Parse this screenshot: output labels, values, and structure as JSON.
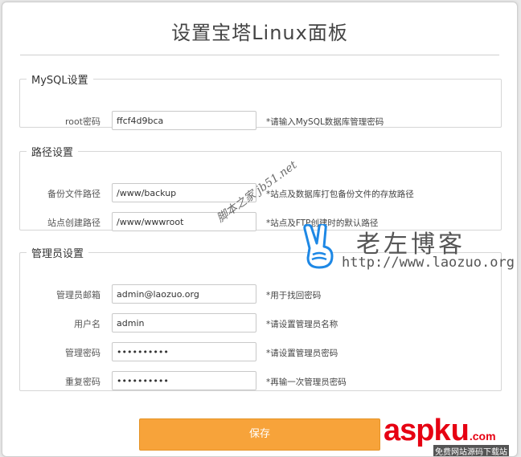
{
  "header": {
    "title": "设置宝塔Linux面板"
  },
  "mysql": {
    "legend": "MySQL设置",
    "root": {
      "label": "root密码",
      "value": "ffcf4d9bca",
      "hint": "*请输入MySQL数据库管理密码"
    }
  },
  "paths": {
    "legend": "路径设置",
    "backup": {
      "label": "备份文件路径",
      "value": "/www/backup",
      "hint": "*站点及数据库打包备份文件的存放路径"
    },
    "site": {
      "label": "站点创建路径",
      "value": "/www/wwwroot",
      "hint": "*站点及FTP创建时的默认路径"
    }
  },
  "admin": {
    "legend": "管理员设置",
    "email": {
      "label": "管理员邮箱",
      "value": "admin@laozuo.org",
      "hint": "*用于找回密码"
    },
    "username": {
      "label": "用户名",
      "value": "admin",
      "hint": "*请设置管理员名称"
    },
    "password": {
      "label": "管理密码",
      "value": "xxxxxxxxxx",
      "hint": "*请设置管理员密码"
    },
    "repeat": {
      "label": "重复密码",
      "value": "xxxxxxxxxx",
      "hint": "*再输一次管理员密码"
    }
  },
  "save_button": {
    "label": "保存"
  },
  "watermarks": {
    "diagonal": "脚本之家 jb51.net",
    "laozuo_cn": "老左博客",
    "laozuo_url": "http://www.laozuo.org",
    "asp_part1": "asp",
    "asp_part2": "ku",
    "asp_part3": ".com",
    "asp_sub": "免费网站源码下载站"
  },
  "colors": {
    "save_button": "#f7a33a",
    "border": "#d6d6d6",
    "asp_red": "#e60012",
    "peace_icon": "#1e88e5"
  }
}
